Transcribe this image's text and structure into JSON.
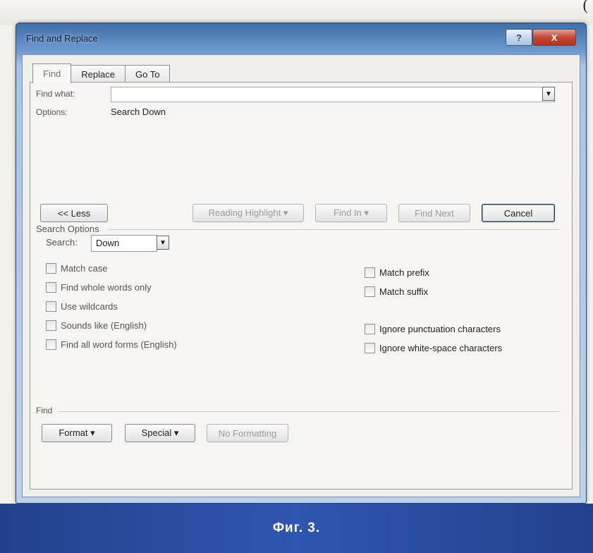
{
  "page": {
    "corner_text": "(",
    "caption": "Фиг. 3."
  },
  "dialog": {
    "title": "Find and Replace",
    "help_label": "?",
    "close_label": "X",
    "tabs": [
      {
        "label": "Find",
        "active": true
      },
      {
        "label": "Replace",
        "active": false
      },
      {
        "label": "Go To",
        "active": false
      }
    ],
    "find_what_label": "Find what:",
    "find_what_value": "",
    "options_label": "Options:",
    "options_value": "Search Down",
    "less_button": "<< Less",
    "reading_highlight_button": "Reading Highlight ▾",
    "find_in_button": "Find In ▾",
    "find_next_button": "Find Next",
    "cancel_button": "Cancel",
    "search_options_label": "Search Options",
    "search_label": "Search:",
    "search_value": "Down",
    "left_options": [
      "Match case",
      "Find whole words only",
      "Use wildcards",
      "Sounds like (English)",
      "Find all word forms (English)"
    ],
    "right_options": [
      "Match prefix",
      "Match suffix",
      "Ignore punctuation characters",
      "Ignore white-space characters"
    ],
    "find_section_label": "Find",
    "format_button": "Format ▾",
    "special_button": "Special ▾",
    "no_formatting_button": "No Formatting"
  }
}
